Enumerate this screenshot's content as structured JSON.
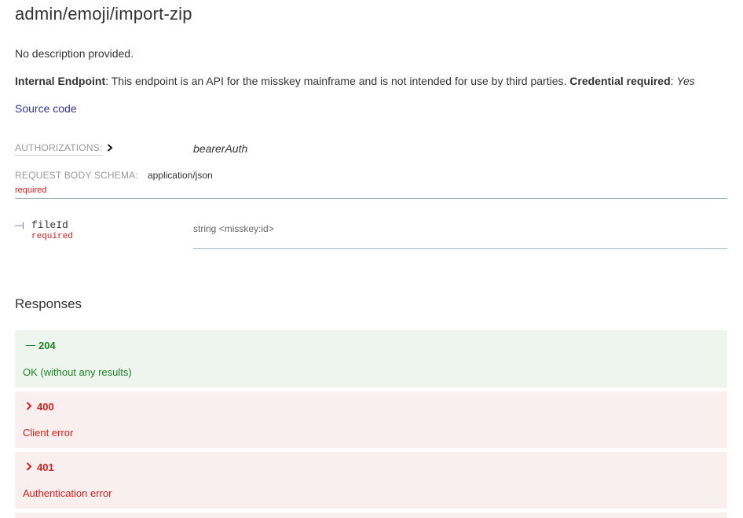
{
  "page": {
    "title": "admin/emoji/import-zip",
    "description": "No description provided.",
    "internal_label": "Internal Endpoint",
    "internal_text": ": This endpoint is an API for the misskey mainframe and is not intended for use by third parties. ",
    "credential_label": "Credential required",
    "credential_sep": ": ",
    "credential_value": "Yes",
    "source_link": "Source code"
  },
  "auth": {
    "label": "AUTHORIZATIONS:",
    "value": "bearerAuth"
  },
  "schema": {
    "label": "REQUEST BODY SCHEMA:",
    "content_type": "application/json",
    "required": "required"
  },
  "fields": [
    {
      "name": "fileId",
      "required": "required",
      "type_prefix": "string",
      "type_format": "<misskey:id>"
    }
  ],
  "responses": {
    "title": "Responses",
    "items": [
      {
        "code": "204",
        "description": "OK (without any results)",
        "kind": "success",
        "expanded": true
      },
      {
        "code": "400",
        "description": "Client error",
        "kind": "error",
        "expanded": false
      },
      {
        "code": "401",
        "description": "Authentication error",
        "kind": "error",
        "expanded": false
      }
    ]
  },
  "colors": {
    "link": "#32329f",
    "required": "#d41f1c",
    "success": "#1d8127",
    "success_bg": "#eef5ee",
    "error_bg": "#faefef"
  },
  "icons": {
    "auth_toggle": "chevron-right-icon",
    "expanded": "dash-icon",
    "collapsed": "chevron-right-icon",
    "field_branch": "tree-branch-icon"
  }
}
